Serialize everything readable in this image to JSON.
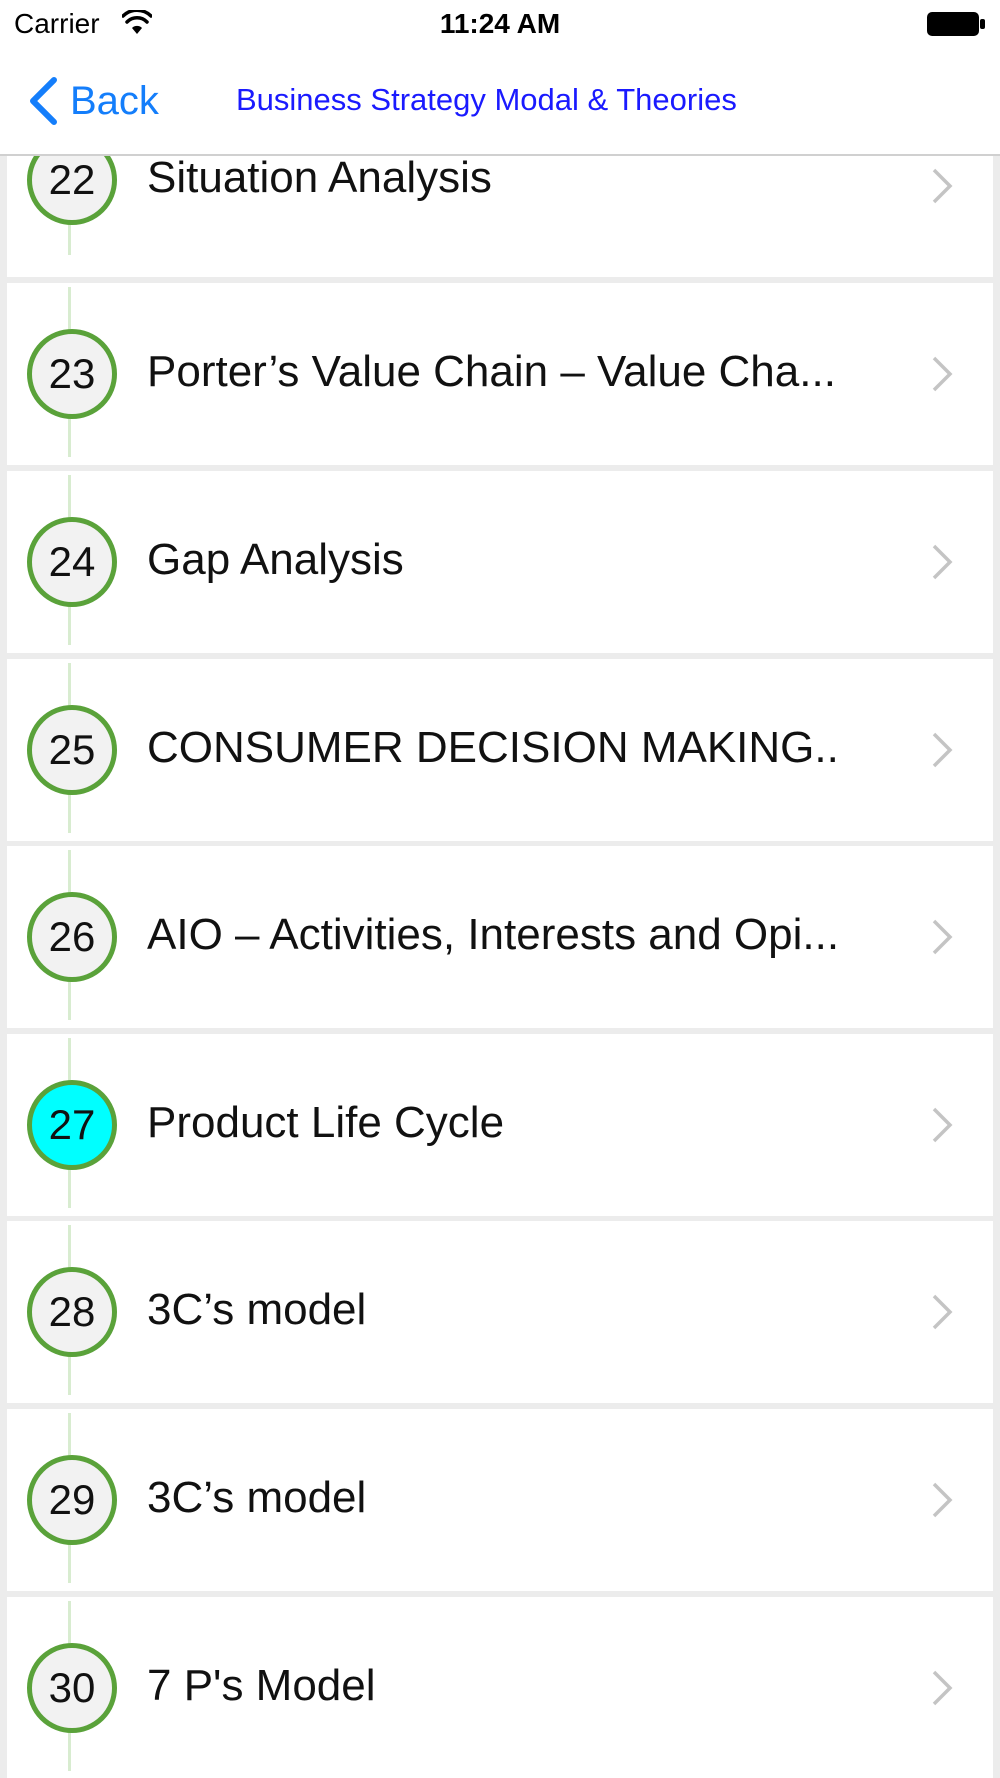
{
  "status_bar": {
    "carrier": "Carrier",
    "time": "11:24 AM"
  },
  "nav": {
    "back_label": "Back",
    "title": "Business Strategy Modal & Theories"
  },
  "colors": {
    "accent_blue": "#147efb",
    "title_blue": "#1a1aff",
    "badge_border": "#5aa23a",
    "badge_active": "#00ffff"
  },
  "items": [
    {
      "number": "22",
      "title": "Situation Analysis",
      "active": false
    },
    {
      "number": "23",
      "title": "Porter’s Value Chain – Value Cha...",
      "active": false
    },
    {
      "number": "24",
      "title": "Gap Analysis",
      "active": false
    },
    {
      "number": "25",
      "title": "CONSUMER DECISION MAKING...",
      "active": false
    },
    {
      "number": "26",
      "title": "AIO – Activities, Interests and Opi...",
      "active": false
    },
    {
      "number": "27",
      "title": "Product Life Cycle",
      "active": true
    },
    {
      "number": "28",
      "title": "3C’s model",
      "active": false
    },
    {
      "number": "29",
      "title": "3C’s model",
      "active": false
    },
    {
      "number": "30",
      "title": "7 P's Model",
      "active": false
    }
  ]
}
